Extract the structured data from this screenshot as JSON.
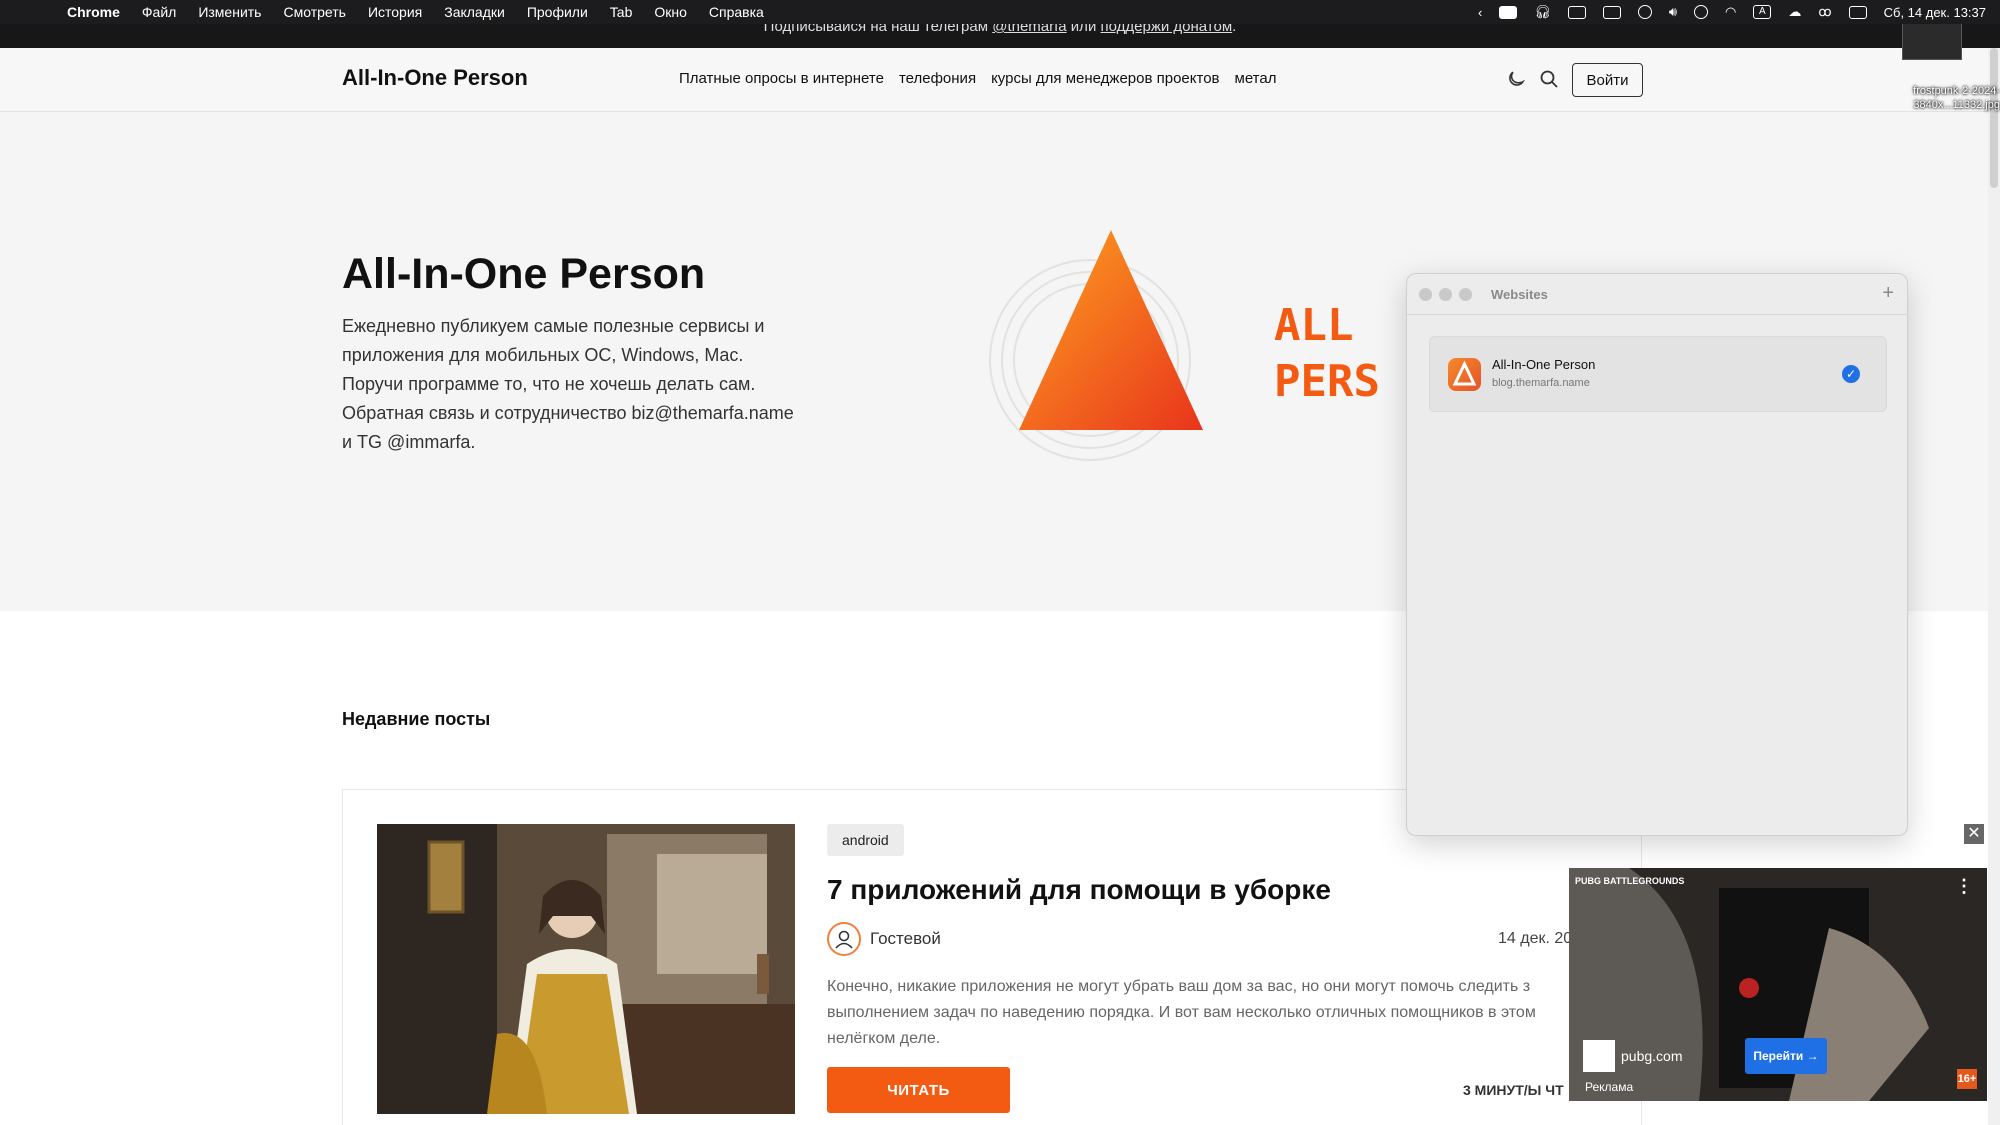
{
  "menubar": {
    "app": "Chrome",
    "items": [
      "Файл",
      "Изменить",
      "Смотреть",
      "История",
      "Закладки",
      "Профили",
      "Tab",
      "Окно",
      "Справка"
    ],
    "input_lang": "A",
    "datetime": "Сб, 14 дек. 13:37"
  },
  "promo": {
    "prefix": "Подписывайся на наш телеграм ",
    "handle": "@themarfa",
    "middle": " или ",
    "donate": "поддержи донатом",
    "suffix": "."
  },
  "header": {
    "logo": "All-In-One Person",
    "nav": [
      "Платные опросы в интернете",
      "телефония",
      "курсы для менеджеров проектов",
      "метал"
    ],
    "login": "Войти"
  },
  "hero": {
    "title": "All-In-One Person",
    "description": "Ежедневно публикуем самые полезные сервисы и приложения для мобильных ОС, Windows, Mac. Поручи программе то, что не хочешь делать сам. Обратная связь и сотрудничество biz@themarfa.name и TG @immarfa.",
    "art_line1": "ALL",
    "art_line2": "PERS",
    "accent": "#f35b13"
  },
  "main": {
    "section_title": "Недавние посты",
    "post": {
      "tag": "android",
      "title": "7 приложений для помощи в уборке",
      "author": "Гостевой",
      "date": "14 дек. 20",
      "excerpt": "Конечно, никакие приложения не могут убрать ваш дом за вас, но они могут помочь следить з выполнением задач по наведению порядка. И вот вам несколько отличных помощников в этом нелёгком деле.",
      "read_label": "ЧИТАТЬ",
      "read_time": "3 МИНУТ/Ы ЧТ"
    }
  },
  "desktop": {
    "file_label": "frostpunk-2-2024-3840x...11332.jpg"
  },
  "panel": {
    "title": "Websites",
    "add_label": "+",
    "site": {
      "name": "All-In-One Person",
      "url": "blog.themarfa.name",
      "check": "✓"
    }
  },
  "ad": {
    "brand": "PUBG BATTLEGROUNDS",
    "site": "pubg.com",
    "go_label": "Перейти →",
    "label": "Реклама",
    "age": "16+",
    "close": "✕",
    "menu": "⋮"
  }
}
